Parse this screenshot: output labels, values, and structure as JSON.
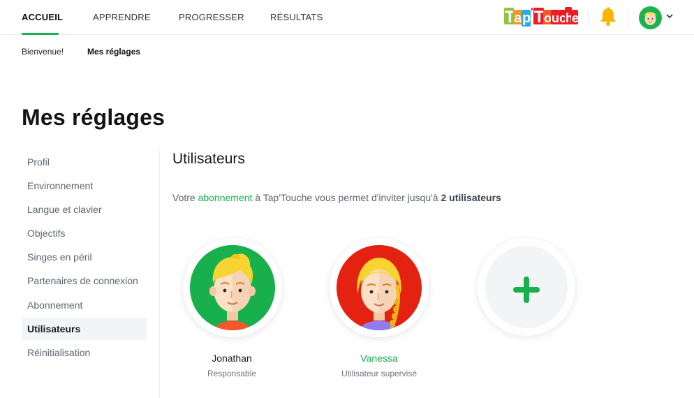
{
  "topnav": {
    "items": [
      {
        "label": "ACCUEIL",
        "active": true
      },
      {
        "label": "APPRENDRE",
        "active": false
      },
      {
        "label": "PROGRESSER",
        "active": false
      },
      {
        "label": "RÉSULTATS",
        "active": false
      }
    ],
    "logo_text": "Tap'Touche",
    "accent_color": "#17b04c"
  },
  "breadcrumb": [
    {
      "label": "Bienvenue!",
      "active": false
    },
    {
      "label": "Mes réglages",
      "active": true
    }
  ],
  "page_title": "Mes réglages",
  "sidebar": {
    "items": [
      {
        "label": "Profil"
      },
      {
        "label": "Environnement"
      },
      {
        "label": "Langue et clavier"
      },
      {
        "label": "Objectifs"
      },
      {
        "label": "Singes en péril"
      },
      {
        "label": "Partenaires de connexion"
      },
      {
        "label": "Abonnement"
      },
      {
        "label": "Utilisateurs",
        "active": true
      },
      {
        "label": "Réinitialisation"
      }
    ]
  },
  "main": {
    "title": "Utilisateurs",
    "subscription": {
      "prefix": "Votre ",
      "link": "abonnement",
      "middle": " à Tap'Touche vous permet d'inviter jusqu'à ",
      "count": "2 utilisateurs"
    },
    "users": [
      {
        "name": "Jonathan",
        "role": "Responsable",
        "bg_color": "#17b04c",
        "shirt_color": "#f4572b"
      },
      {
        "name": "Vanessa",
        "role": "Utilisateur supervisé",
        "bg_color": "#e42212",
        "shirt_color": "#8e7cf0"
      }
    ],
    "add_icon": "plus-icon"
  }
}
